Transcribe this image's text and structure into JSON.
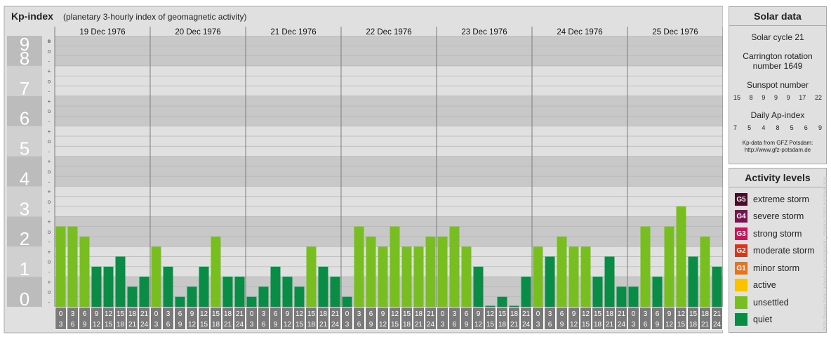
{
  "header": {
    "title": "Kp-index",
    "subtitle": "(planetary 3-hourly index of geomagnetic activity)"
  },
  "chart_data": {
    "type": "bar",
    "title": "Kp-index",
    "subtitle": "(planetary 3-hourly index of geomagnetic activity)",
    "ylim": [
      0,
      9
    ],
    "y_ticks": [
      "0",
      "1",
      "2",
      "3",
      "4",
      "5",
      "6",
      "7",
      "8",
      "9"
    ],
    "y_minor_labels": [
      "+",
      "o",
      "-"
    ],
    "days": [
      "19 Dec 1976",
      "20 Dec 1976",
      "21 Dec 1976",
      "22 Dec 1976",
      "23 Dec 1976",
      "24 Dec 1976",
      "25 Dec 1976"
    ],
    "intervals": [
      [
        "0",
        "3"
      ],
      [
        "3",
        "6"
      ],
      [
        "6",
        "9"
      ],
      [
        "9",
        "12"
      ],
      [
        "12",
        "15"
      ],
      [
        "15",
        "18"
      ],
      [
        "18",
        "21"
      ],
      [
        "21",
        "24"
      ]
    ],
    "values": [
      [
        2.667,
        2.667,
        2.333,
        1.333,
        1.333,
        1.667,
        0.667,
        1.0
      ],
      [
        2.0,
        1.333,
        0.333,
        0.667,
        1.333,
        2.333,
        1.0,
        1.0
      ],
      [
        0.333,
        0.667,
        1.333,
        1.0,
        0.667,
        2.0,
        1.333,
        1.0
      ],
      [
        0.333,
        2.667,
        2.333,
        2.0,
        2.667,
        2.0,
        2.0,
        2.333
      ],
      [
        2.333,
        2.667,
        2.0,
        1.333,
        0.0,
        0.333,
        0.0,
        1.0
      ],
      [
        2.0,
        1.667,
        2.333,
        2.0,
        2.0,
        1.0,
        1.667,
        0.667
      ],
      [
        0.667,
        2.667,
        1.0,
        2.667,
        3.333,
        1.667,
        2.333,
        1.333
      ]
    ],
    "colors": {
      "quiet": "#0a8c46",
      "unsettled": "#78be20",
      "active": "#fcc200"
    },
    "grid": true
  },
  "solar": {
    "title": "Solar data",
    "cycle": "Solar cycle 21",
    "carrington_line1": "Carrington rotation",
    "carrington_line2": "number 1649",
    "sunspot_label": "Sunspot number",
    "sunspot": [
      "15",
      "8",
      "9",
      "9",
      "9",
      "17",
      "22"
    ],
    "ap_label": "Daily Ap-index",
    "ap": [
      "7",
      "5",
      "4",
      "8",
      "5",
      "6",
      "9"
    ],
    "source_line1": "Kp-data from GFZ Potsdam:",
    "source_line2": "http://www.gfz-potsdam.de"
  },
  "activity": {
    "title": "Activity levels",
    "items": [
      {
        "code": "G5",
        "label": "extreme storm",
        "color": "#4a0a28",
        "icon": "g5-badge-icon"
      },
      {
        "code": "G4",
        "label": "severe storm",
        "color": "#7a1450",
        "icon": "g4-badge-icon"
      },
      {
        "code": "G3",
        "label": "strong storm",
        "color": "#c2185b",
        "icon": "g3-badge-icon"
      },
      {
        "code": "G2",
        "label": "moderate storm",
        "color": "#d2381e",
        "icon": "g2-badge-icon"
      },
      {
        "code": "G1",
        "label": "minor storm",
        "color": "#e8731c",
        "icon": "g1-badge-icon"
      },
      {
        "code": "",
        "label": "active",
        "color": "#fcc200",
        "icon": "active-swatch-icon"
      },
      {
        "code": "",
        "label": "unsettled",
        "color": "#78be20",
        "icon": "unsettled-swatch-icon"
      },
      {
        "code": "",
        "label": "quiet",
        "color": "#0a8c46",
        "icon": "quiet-swatch-icon"
      }
    ]
  },
  "credit": "http://www.tesis.lebedev.ru/magnetic_storms.html archive.php"
}
